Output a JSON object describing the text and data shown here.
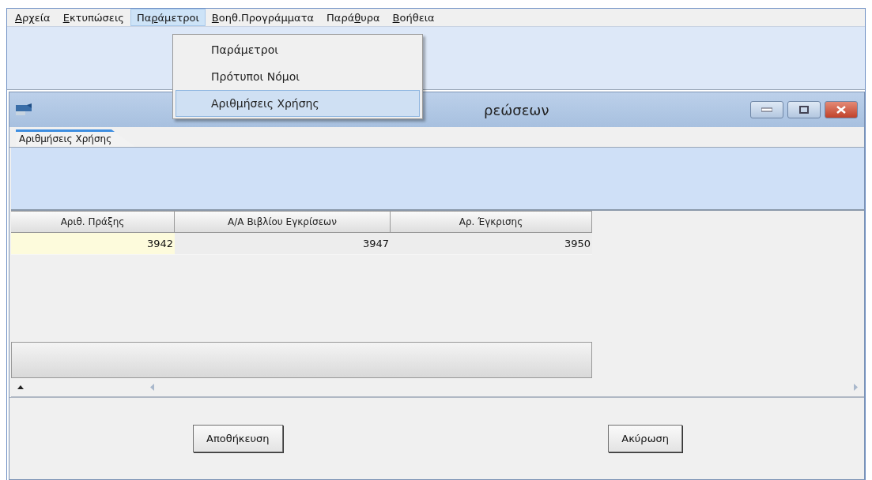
{
  "menu_bar": [
    {
      "key": "Α",
      "post": "ρχεία",
      "selected": false
    },
    {
      "key": "Ε",
      "post": "κτυπώσεις",
      "selected": false
    },
    {
      "pre": "Πα",
      "key": "ρ",
      "post": "άμετροι",
      "selected": true
    },
    {
      "key": "Β",
      "post": "οηθ.Προγράμματα",
      "selected": false
    },
    {
      "pre": "Παρά",
      "key": "θ",
      "post": "υρα",
      "selected": false
    },
    {
      "key": "Β",
      "post": "οήθεια",
      "selected": false
    }
  ],
  "dropdown": [
    {
      "label": "Παράμετροι",
      "selected": false
    },
    {
      "label": "Πρότυποι Νόμοι",
      "selected": false
    },
    {
      "label": "Αριθμήσεις Χρήσης",
      "selected": true
    }
  ],
  "window": {
    "title": "ρεώσεων"
  },
  "tabs": [
    {
      "label": "Αριθμήσεις Χρήσης",
      "selected": true
    }
  ],
  "table": {
    "columns": [
      "Αριθ. Πράξης",
      "Α/Α Βιβλίου Εγκρίσεων",
      "Αρ. Έγκρισης"
    ],
    "rows": [
      {
        "cells": [
          "3942",
          "3947",
          "3950"
        ],
        "selected": true
      }
    ]
  },
  "buttons": [
    "Αποθήκευση",
    "Ακύρωση"
  ]
}
